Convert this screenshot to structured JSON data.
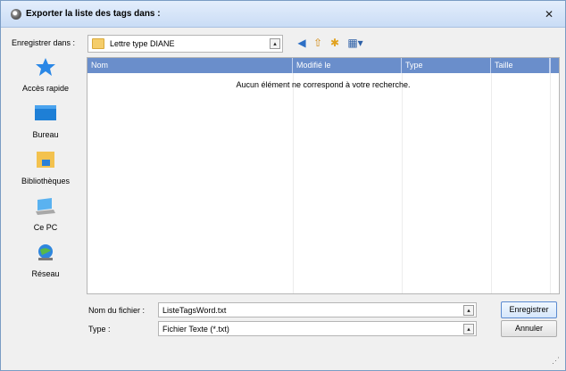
{
  "window": {
    "title": "Exporter la liste des tags dans :",
    "close": "✕"
  },
  "toolbar": {
    "save_in_label": "Enregistrer dans :",
    "current_folder": "Lettre type DIANE",
    "combo_arrow": "▴",
    "back_icon": "◀",
    "up_icon": "⇧",
    "new_folder_icon": "✱",
    "view_icon": "▦▾"
  },
  "places": [
    {
      "label": "Accès rapide",
      "icon": "star-icon"
    },
    {
      "label": "Bureau",
      "icon": "desktop-icon"
    },
    {
      "label": "Bibliothèques",
      "icon": "libraries-icon"
    },
    {
      "label": "Ce PC",
      "icon": "computer-icon"
    },
    {
      "label": "Réseau",
      "icon": "network-icon"
    }
  ],
  "filelist": {
    "columns": [
      "Nom",
      "Modifié le",
      "Type",
      "Taille"
    ],
    "empty_message": "Aucun élément ne correspond à votre recherche."
  },
  "form": {
    "filename_label": "Nom du fichier :",
    "filename_value": "ListeTagsWord.txt",
    "type_label": "Type :",
    "type_value": "Fichier Texte (*.txt)",
    "save_button": "Enregistrer",
    "cancel_button": "Annuler"
  },
  "colors": {
    "header_blue": "#6a8ecb",
    "accent": "#1e90ff"
  }
}
